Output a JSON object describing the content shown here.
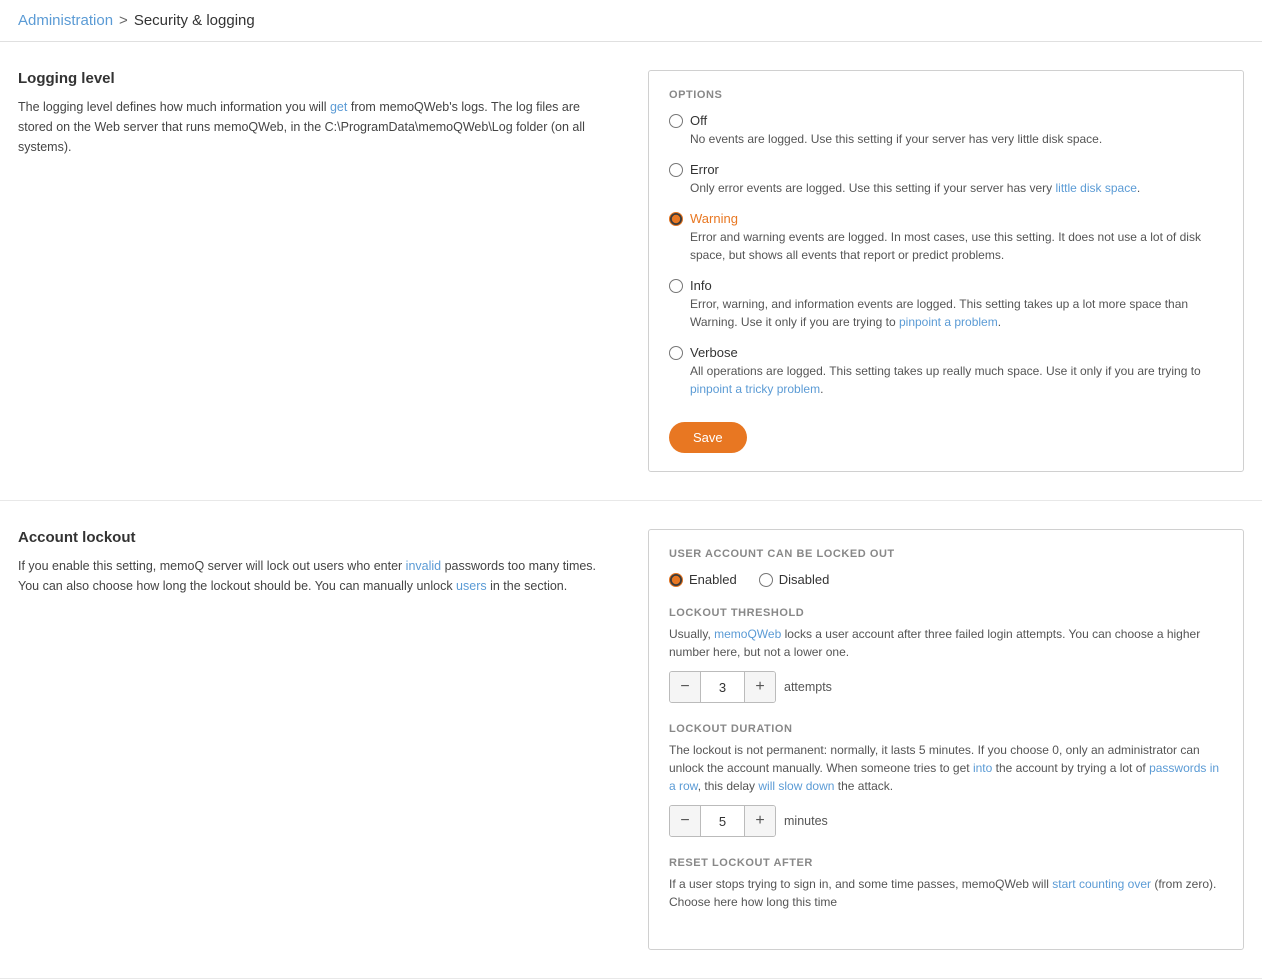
{
  "breadcrumb": {
    "admin_label": "Administration",
    "sep": ">",
    "current_label": "Security & logging"
  },
  "logging_section": {
    "title": "Logging level",
    "description": "The logging level defines how much information you will get from memoQWeb's logs. The log files are stored on the Web server that runs memoQWeb, in the C:\\ProgramData\\memoQWeb\\Log folder (on all systems).",
    "options_label": "OPTIONS",
    "options": [
      {
        "id": "off",
        "label": "Off",
        "desc": "No events are logged. Use this setting if your server has very little disk space.",
        "selected": false
      },
      {
        "id": "error",
        "label": "Error",
        "desc": "Only error events are logged. Use this setting if your server has very little disk space.",
        "selected": false
      },
      {
        "id": "warning",
        "label": "Warning",
        "desc": "Error and warning events are logged. In most cases, use this setting. It does not use a lot of disk space, but shows all events that report or predict problems.",
        "selected": true
      },
      {
        "id": "info",
        "label": "Info",
        "desc": "Error, warning, and information events are logged. This setting takes up a lot more space than Warning. Use it only if you are trying to pinpoint a problem.",
        "selected": false
      },
      {
        "id": "verbose",
        "label": "Verbose",
        "desc": "All operations are logged. This setting takes up really much space. Use it only if you are trying to pinpoint a tricky problem.",
        "selected": false
      }
    ],
    "save_label": "Save"
  },
  "lockout_section": {
    "title": "Account lockout",
    "description": "If you enable this setting, memoQ server will lock out users who enter invalid passwords too many times. You can also choose how long the lockout should be. You can manually unlock users in the  section.",
    "options_label": "USER ACCOUNT CAN BE LOCKED OUT",
    "enabled_label": "Enabled",
    "disabled_label": "Disabled",
    "threshold": {
      "label": "LOCKOUT THRESHOLD",
      "desc": "Usually, memoQWeb locks a user account after three failed login attempts. You can choose a higher number here, but not a lower one.",
      "value": "3",
      "unit": "attempts"
    },
    "duration": {
      "label": "LOCKOUT DURATION",
      "desc": "The lockout is not permanent: normally, it lasts 5 minutes. If you choose 0, only an administrator can unlock the account manually. When someone tries to get into the account by trying a lot of passwords in a row, this delay will slow down the attack.",
      "value": "5",
      "unit": "minutes"
    },
    "reset": {
      "label": "RESET LOCKOUT AFTER",
      "desc": "If a user stops trying to sign in, and some time passes, memoQWeb will start counting over (from zero). Choose here how long this time"
    }
  }
}
